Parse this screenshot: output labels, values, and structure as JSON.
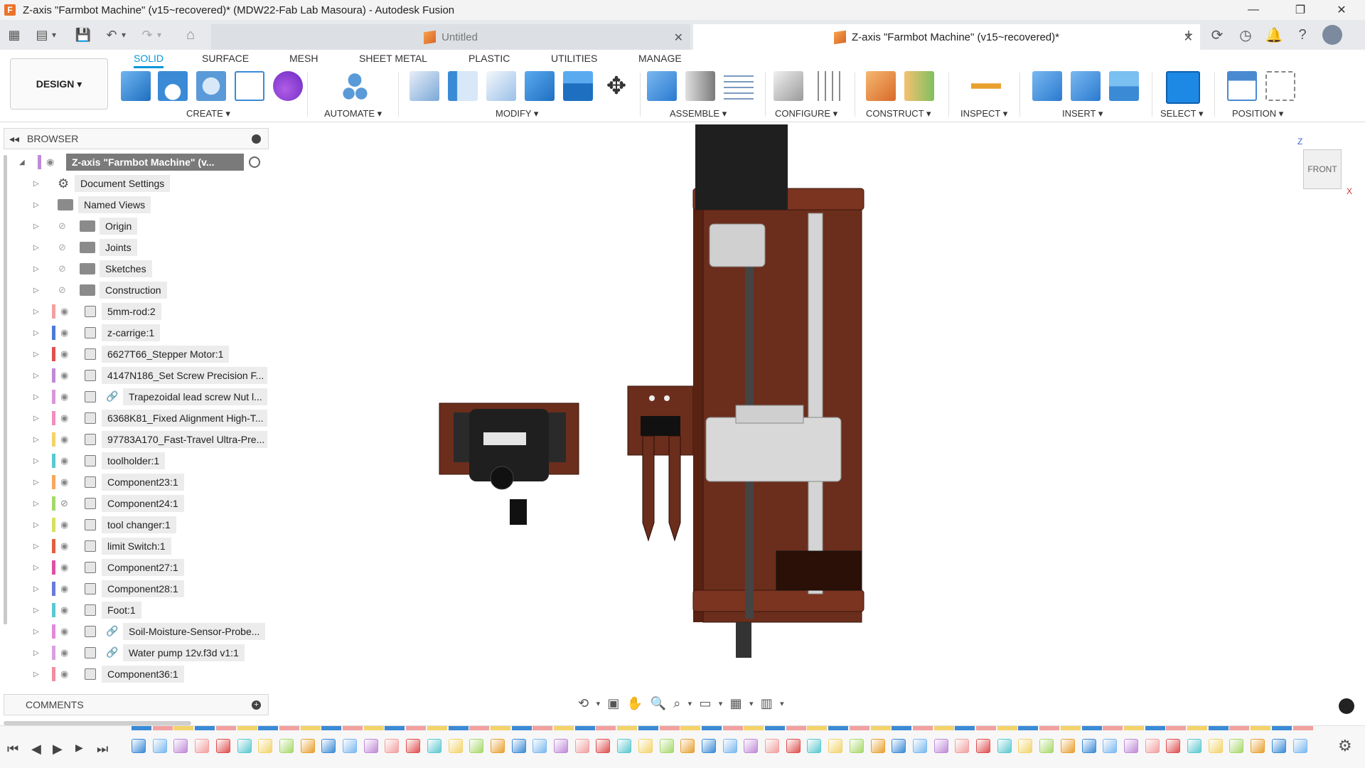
{
  "window": {
    "title": "Z-axis \"Farmbot Machine\" (v15~recovered)* (MDW22-Fab Lab Masoura) - Autodesk Fusion",
    "logo_letter": "F",
    "controls": {
      "minimize": "—",
      "restore": "❐",
      "close": "✕"
    }
  },
  "quick_access": {
    "grid": "▦",
    "file": "▤",
    "file_caret": "▾",
    "save": "💾",
    "undo": "↶",
    "undo_caret": "▾",
    "redo": "↷",
    "redo_caret": "▾",
    "home": "⌂"
  },
  "tabs": [
    {
      "label": "Untitled",
      "close": "✕"
    },
    {
      "label": "Z-axis \"Farmbot Machine\" (v15~recovered)*",
      "close": "✕"
    }
  ],
  "tab_actions": {
    "new_tab": "+",
    "extensions": "⟳",
    "job_status": "◷",
    "notifications": "🔔",
    "help": "?"
  },
  "workspace": {
    "label": "DESIGN ▾"
  },
  "workspace_tabs": [
    "SOLID",
    "SURFACE",
    "MESH",
    "SHEET METAL",
    "PLASTIC",
    "UTILITIES",
    "MANAGE"
  ],
  "tool_groups": [
    {
      "label": "CREATE ▾"
    },
    {
      "label": "AUTOMATE ▾"
    },
    {
      "label": "MODIFY ▾"
    },
    {
      "label": "ASSEMBLE ▾"
    },
    {
      "label": "CONFIGURE ▾"
    },
    {
      "label": "CONSTRUCT ▾"
    },
    {
      "label": "INSPECT ▾"
    },
    {
      "label": "INSERT ▾"
    },
    {
      "label": "SELECT ▾"
    },
    {
      "label": "POSITION ▾"
    }
  ],
  "browser": {
    "title": "BROWSER",
    "collapse_glyph": "◂◂",
    "root": "Z-axis \"Farmbot Machine\" (v...",
    "items": [
      {
        "label": "Document Settings",
        "type": "settings"
      },
      {
        "label": "Named Views",
        "type": "folder"
      },
      {
        "label": "Origin",
        "type": "folder",
        "hidden": true
      },
      {
        "label": "Joints",
        "type": "folder",
        "hidden": true
      },
      {
        "label": "Sketches",
        "type": "folder",
        "hidden": true
      },
      {
        "label": "Construction",
        "type": "folder",
        "hidden": true
      },
      {
        "label": "5mm-rod:2",
        "type": "component",
        "color": "#f2a0a0"
      },
      {
        "label": "z-carrige:1",
        "type": "component",
        "color": "#4a7bd8"
      },
      {
        "label": "6627T66_Stepper Motor:1",
        "type": "component",
        "color": "#e05050"
      },
      {
        "label": "4147N186_Set Screw Precision F...",
        "type": "component",
        "color": "#c08ad8"
      },
      {
        "label": "Trapezoidal lead screw Nut l...",
        "type": "link",
        "color": "#d898d8"
      },
      {
        "label": "6368K81_Fixed Alignment High-T...",
        "type": "component",
        "color": "#f08fc0"
      },
      {
        "label": "97783A170_Fast-Travel Ultra-Pre...",
        "type": "component",
        "color": "#f3d36a"
      },
      {
        "label": "toolholder:1",
        "type": "component",
        "color": "#5bc8d0"
      },
      {
        "label": "Component23:1",
        "type": "component",
        "color": "#f5a860"
      },
      {
        "label": "Component24:1",
        "type": "component",
        "color": "#a7d86a",
        "hidden": true
      },
      {
        "label": "tool changer:1",
        "type": "component",
        "color": "#d8e060"
      },
      {
        "label": "limit Switch:1",
        "type": "component",
        "color": "#e06040"
      },
      {
        "label": "Component27:1",
        "type": "component",
        "color": "#e050a0"
      },
      {
        "label": "Component28:1",
        "type": "component",
        "color": "#6a7ad8"
      },
      {
        "label": "Foot:1",
        "type": "component",
        "color": "#5bc8d0"
      },
      {
        "label": "Soil-Moisture-Sensor-Probe...",
        "type": "link",
        "color": "#e08ad8"
      },
      {
        "label": "Water pump 12v.f3d  v1:1",
        "type": "link",
        "color": "#d8a0e0"
      },
      {
        "label": "Component36:1",
        "type": "component",
        "color": "#f08fa0"
      }
    ]
  },
  "comments": {
    "title": "COMMENTS",
    "add": "+"
  },
  "viewcube": {
    "face": "FRONT",
    "axis_z": "Z",
    "axis_x": "X"
  },
  "nav_bar": {
    "orbit": "⟲",
    "orbit_caret": "▾",
    "look_at": "▣",
    "pan": "✋",
    "zoom": "🔍",
    "fit": "⌕",
    "fit_caret": "▾",
    "display_settings": "▭",
    "display_caret": "▾",
    "grid": "▦",
    "grid_caret": "▾",
    "viewports": "▥",
    "viewports_caret": "▾"
  },
  "timeline_controls": {
    "first": "⏮",
    "previous": "◀",
    "play": "▶",
    "next": "▶",
    "last": "⏭",
    "settings": "⚙"
  },
  "colors": {
    "accent": "#0696d7",
    "wood": "#6b2e1c",
    "motor": "#222222",
    "metal": "#c8c8c8"
  }
}
